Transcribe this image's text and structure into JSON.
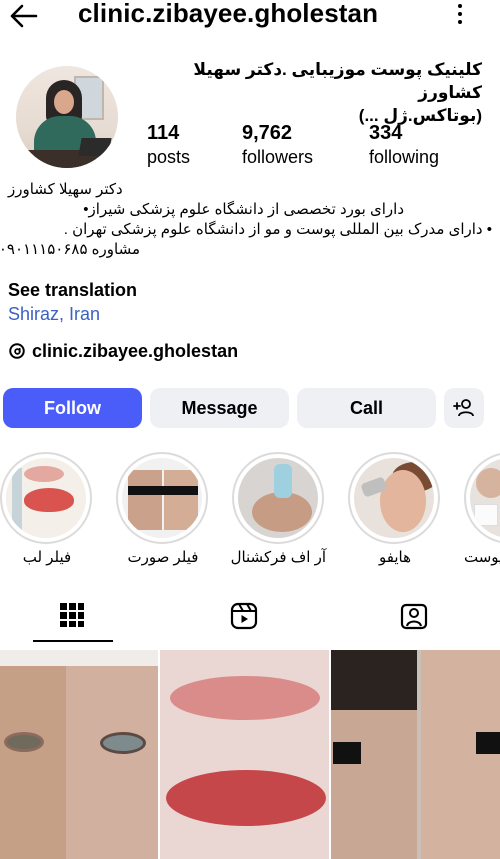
{
  "header": {
    "username": "clinic.zibayee.gholestan",
    "back_icon": "arrow-left-icon",
    "menu_icon": "more-vertical-icon"
  },
  "profile": {
    "full_name_line1": "کلینیک پوست موزیبایی .دکتر سهیلا کشاورز",
    "full_name_line2": "(بوتاکس.ژل ...)",
    "stats": {
      "posts_value": "114",
      "posts_label": "posts",
      "followers_value": "9,762",
      "followers_label": "followers",
      "following_value": "334",
      "following_label": "following"
    }
  },
  "bio": {
    "line1": "دکتر سهیلا کشاورز",
    "line2": "دارای بورد تخصصی از دانشگاه علوم پزشکی شیراز•",
    "line3": "• دارای مدرک بین المللی پوست و مو از دانشگاه علوم پزشکی تهران .",
    "line4": "مشاوره ۰۹۰۱۱۱۵۰۶۸۵",
    "see_translation": "See translation",
    "location": "Shiraz, Iran",
    "threads_handle": "clinic.zibayee.gholestan"
  },
  "actions": {
    "follow": "Follow",
    "message": "Message",
    "call": "Call",
    "add_user_icon": "add-person-icon"
  },
  "highlights": [
    {
      "label": "فیلر لب"
    },
    {
      "label": "فیلر صورت"
    },
    {
      "label": "آر اف فرکشنال"
    },
    {
      "label": "هایفو"
    },
    {
      "label": "پوست"
    }
  ],
  "tabs": {
    "active": "grid",
    "icons": [
      "grid-icon",
      "reels-icon",
      "tagged-icon"
    ]
  },
  "colors": {
    "follow_button": "#4a5df9",
    "secondary_button": "#eef0f3",
    "link": "#3a61c4"
  }
}
